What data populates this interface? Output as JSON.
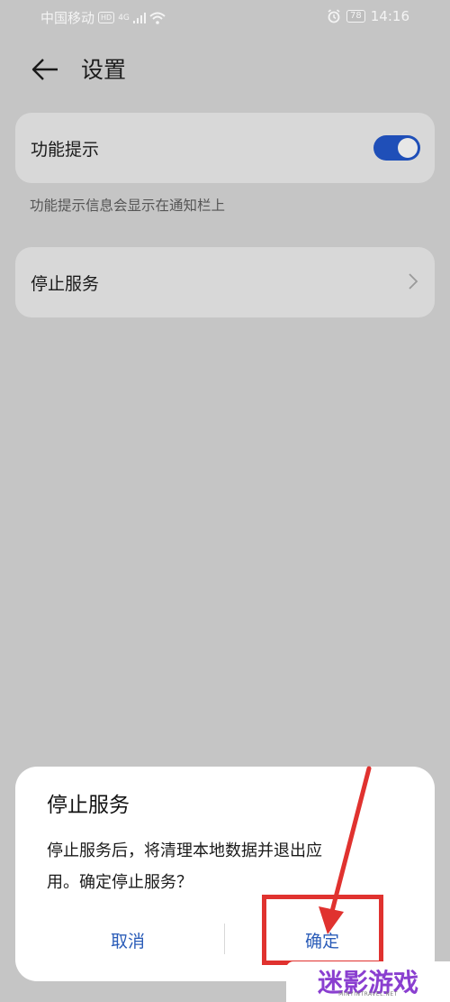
{
  "status_bar": {
    "carrier": "中国移动",
    "hd": "HD",
    "network": "4G",
    "battery": "78",
    "time": "14:16"
  },
  "header": {
    "back_icon": "arrow-left-icon",
    "title": "设置"
  },
  "settings": {
    "feature_hint": {
      "label": "功能提示",
      "toggle_on": true,
      "description": "功能提示信息会显示在通知栏上"
    },
    "stop_service": {
      "label": "停止服务",
      "chevron_icon": "chevron-right-icon"
    }
  },
  "dialog": {
    "title": "停止服务",
    "message_line1": "停止服务后，将清理本地数据并退出应",
    "message_line2": "用。确定停止服务？",
    "cancel_label": "取消",
    "confirm_label": "确定"
  },
  "annotation": {
    "highlight_color": "#e0322f"
  },
  "watermark": {
    "text": "迷影游戏",
    "subtext": "MINYINTRAVEL.NET"
  },
  "colors": {
    "accent": "#1f4fb8",
    "dialog_button": "#2a5cb8"
  }
}
